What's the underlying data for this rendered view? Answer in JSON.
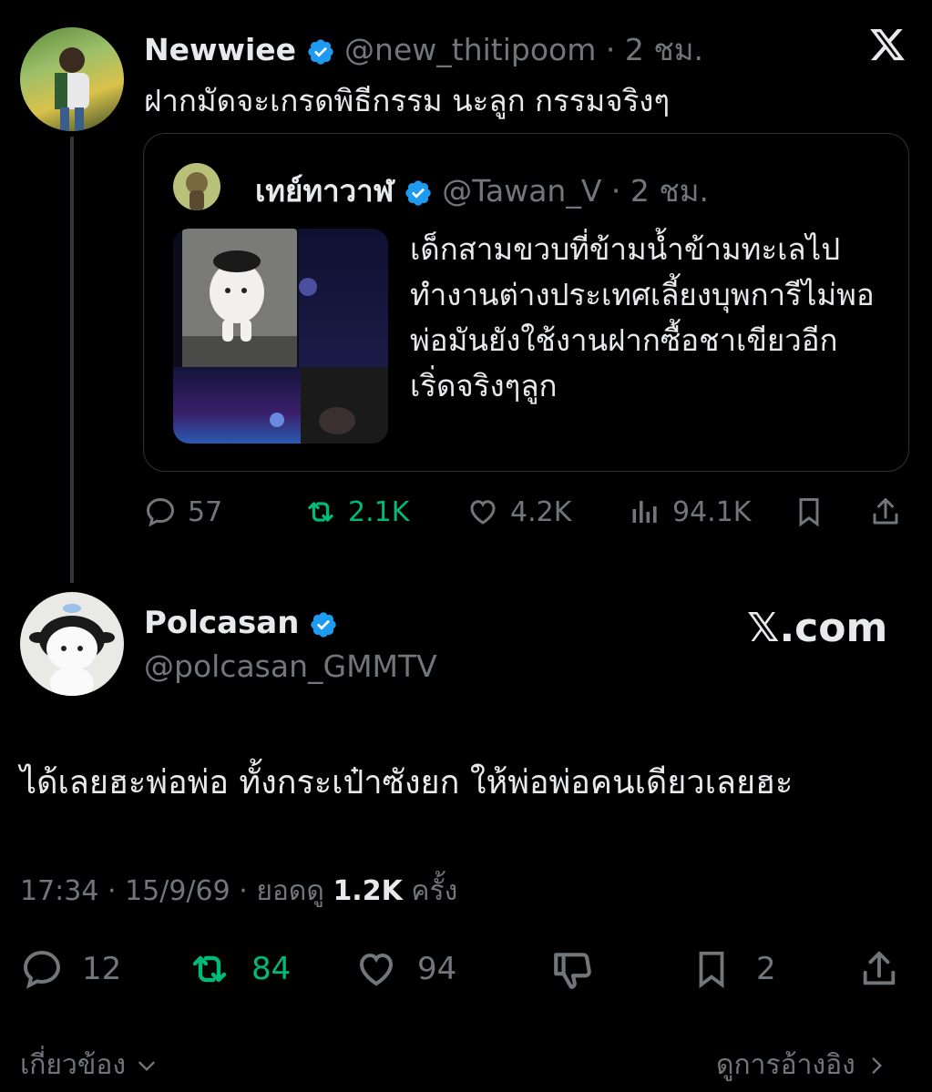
{
  "parent_tweet": {
    "name": "Newwiee",
    "handle": "@new_thitipoom",
    "sep": "·",
    "time": "2 ชม.",
    "text": "ฝากมัดจะเกรดพิธีกรรม นะลูก กรรมจริงๆ",
    "quote": {
      "name": "เทย์ทาวาฬ",
      "handle": "@Tawan_V",
      "sep": "·",
      "time": "2 ชม.",
      "text": "เด็กสามขวบที่ข้ามน้ำข้ามทะเลไปทำงานต่างประเทศเลี้ยงบุพการีไม่พอ พ่อมันยังใช้งานฝากซื้อชาเขียวอีก เริ่ดจริงๆลูก"
    },
    "actions": {
      "replies": "57",
      "retweets": "2.1K",
      "likes": "4.2K",
      "views": "94.1K"
    }
  },
  "main_tweet": {
    "name": "Polcasan",
    "handle": "@polcasan_GMMTV",
    "text": "ได้เลยฮะพ่อพ่อ ทั้งกระเป๋าซังยก ให้พ่อพ่อคนเดียวเลยฮะ",
    "meta": {
      "time": "17:34 · 15/9/69 · ยอดดู",
      "views": "1.2K",
      "views_suffix": "ครั้ง"
    },
    "actions": {
      "replies": "12",
      "retweets": "84",
      "likes": "94",
      "bookmarks": "2"
    }
  },
  "watermark": "𝕏.com",
  "footer": {
    "related": "เกี่ยวข้อง",
    "see_quotes": "ดูการอ้างอิง"
  },
  "colors": {
    "background": "#000000",
    "text": "#e7e9ea",
    "muted": "#71767b",
    "verified": "#1d9bf0",
    "retweet": "#00ba7c"
  },
  "icons": [
    "x-logo-icon",
    "verified-icon",
    "reply-icon",
    "retweet-icon",
    "like-icon",
    "views-icon",
    "bookmark-icon",
    "share-icon",
    "dislike-icon",
    "chevron-down-icon",
    "chevron-right-icon"
  ]
}
